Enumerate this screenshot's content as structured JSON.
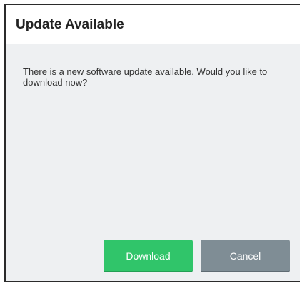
{
  "dialog": {
    "title": "Update Available",
    "message": "There is a new software update available. Would you like to download now?",
    "buttons": {
      "download_label": "Download",
      "cancel_label": "Cancel"
    }
  },
  "colors": {
    "download_button": "#30c56a",
    "cancel_button": "#7f8d95",
    "body_background": "#eef0f2",
    "header_background": "#ffffff"
  }
}
